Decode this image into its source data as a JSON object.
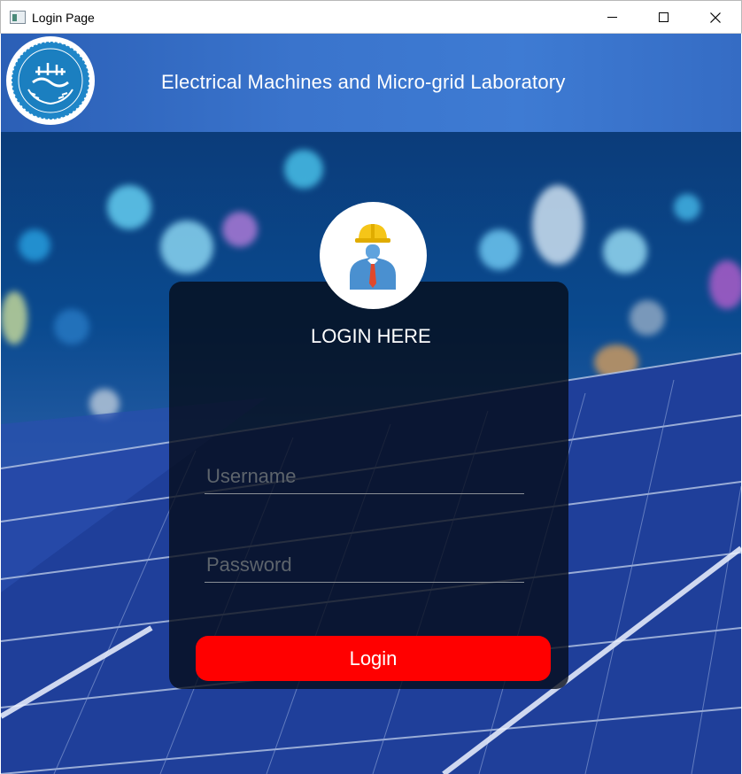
{
  "window": {
    "title": "Login Page",
    "controls": [
      "minimize",
      "maximize",
      "close"
    ]
  },
  "header": {
    "title": "Electrical Machines and Micro-grid Laboratory",
    "logo_icon": "university-of-tehran-seal"
  },
  "login": {
    "avatar_icon": "engineer-hardhat-icon",
    "heading": "LOGIN HERE",
    "username": {
      "value": "",
      "placeholder": "Username"
    },
    "password": {
      "value": "",
      "placeholder": "Password"
    },
    "button_label": "Login"
  },
  "colors": {
    "header_blue": "#3a74cc",
    "button_red": "#ff0000",
    "card_bg": "#050a16"
  }
}
